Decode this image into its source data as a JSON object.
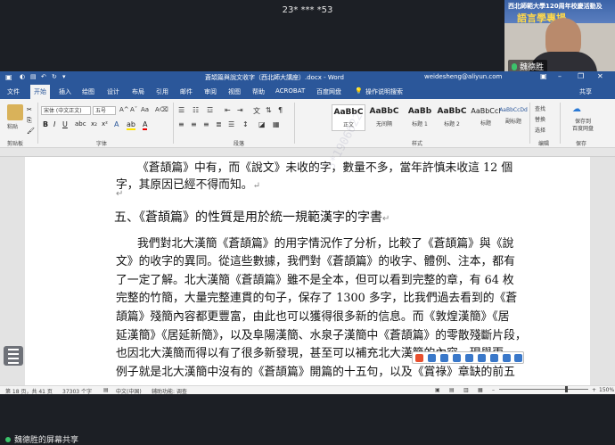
{
  "share": {
    "title": "23* *** *53",
    "presenter_label": "魏德胜的屏幕共享"
  },
  "video": {
    "banner_line1": "西北師範大學120周年校慶活動及",
    "banner_line2": "語言學專場",
    "name": "魏德胜"
  },
  "word": {
    "doc_title": "蒼頡篇與說文收字（西北師大講座）.docx  -  Word",
    "user_email": "weidesheng@aliyun.com",
    "tabs": [
      "文件",
      "开始",
      "插入",
      "绘图",
      "设计",
      "布局",
      "引用",
      "邮件",
      "审阅",
      "视图",
      "帮助",
      "ACROBAT",
      "百度网盘"
    ],
    "tell_me": "操作说明搜索",
    "share": "共享",
    "ribbon": {
      "paste": "粘贴",
      "clipboard": "剪贴板",
      "font_name": "宋体 (中文正文)",
      "font_size": "五号",
      "font_group": "字体",
      "paragraph_group": "段落",
      "styles_group": "样式",
      "edit_group": "编辑",
      "save_group": "保存",
      "find": "查找",
      "replace": "替换",
      "select": "选择",
      "save_baidu": "保存到\n百度网盘",
      "styles": [
        {
          "sample": "AaBbC",
          "name": "正文"
        },
        {
          "sample": "AaBbC",
          "name": "无间隔"
        },
        {
          "sample": "AaBb",
          "name": "标题 1"
        },
        {
          "sample": "AaBbC",
          "name": "标题 2"
        },
        {
          "sample": "AaBbCcI",
          "name": "标题"
        },
        {
          "sample": "AaBbCcDd",
          "name": "副标题"
        }
      ]
    },
    "status": {
      "page": "第 18 页，共 41 页",
      "words": "37303 个字",
      "lang": "中文(中国)",
      "access": "辅助功能: 调查",
      "zoom": "150%"
    }
  },
  "document": {
    "line1": "《蒼頡篇》中有，而《說文》未收的字，數量不多，當年許慎未收這 12 個",
    "line2": "字，其原因已經不得而知。",
    "heading": "五、《蒼頡篇》的性質是用於統一規範漢字的字書",
    "paragraph": [
      "我們對北大漢簡《蒼頡篇》的用字情況作了分析，比較了《蒼頡篇》與《說",
      "文》的收字的異同。從這些數據，我們對《蒼頡篇》的收字、體例、注本，都有",
      "了一定了解。北大漢簡《蒼頡篇》雖不是全本，但可以看到完整的章，有 64 枚",
      "完整的竹簡，大量完整連貫的句子，保存了 1300 多字，比我們過去看到的《蒼",
      "頡篇》殘簡內容都更豐富，由此也可以獲得很多新的信息。而《敦煌漢簡》《居",
      "延漢簡》《居延新簡》，以及阜陽漢簡、水泉子漢簡中《蒼頡篇》的零散殘斷片段，",
      "也因北大漢簡而得以有了很多新發現，甚至可以補充北大漢簡的內容。現舉兩",
      "例子就是北大漢簡中沒有的《蒼頡篇》開篇的十五句，以及《賞祿》章缺的前五"
    ],
    "watermark": "3*1906622"
  }
}
